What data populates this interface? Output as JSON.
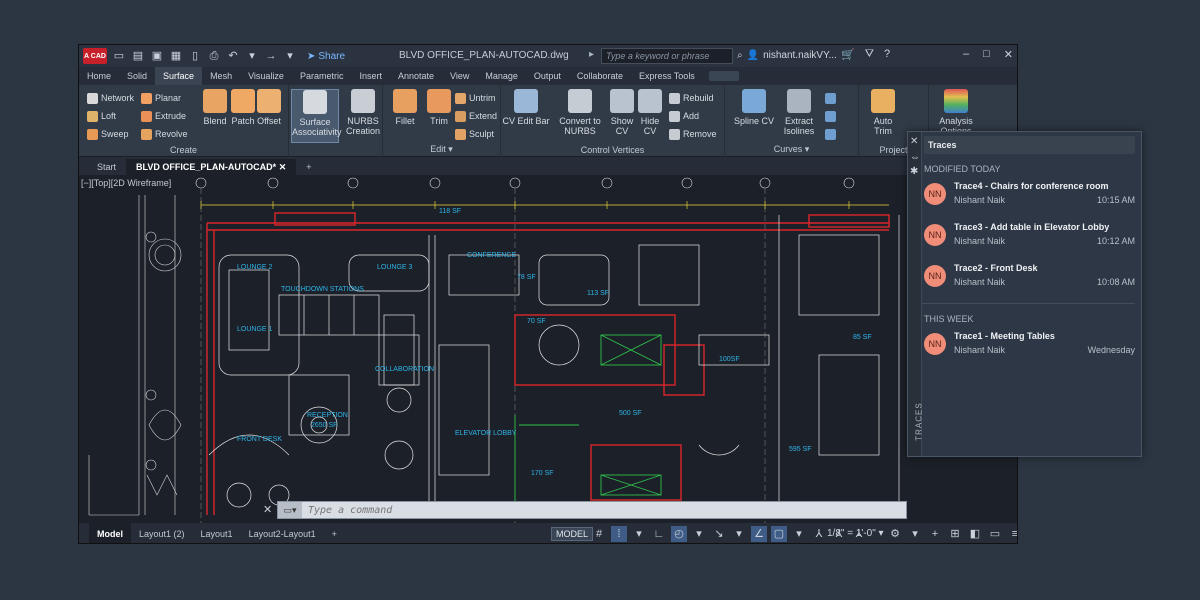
{
  "titlebar": {
    "app_badge": "A CAD",
    "share": "Share",
    "doc_title": "BLVD OFFICE_PLAN-AUTOCAD.dwg",
    "search_placeholder": "Type a keyword or phrase",
    "user": "nishant.naikVY...",
    "window_controls": [
      "–",
      "□",
      "✕"
    ]
  },
  "menu": {
    "tabs": [
      "Home",
      "Solid",
      "Surface",
      "Mesh",
      "Visualize",
      "Parametric",
      "Insert",
      "Annotate",
      "View",
      "Manage",
      "Output",
      "Collaborate",
      "Express Tools"
    ],
    "active": "Surface"
  },
  "ribbon": {
    "create": {
      "title": "Create",
      "small": [
        "Network",
        "Loft",
        "Sweep",
        "Planar",
        "Extrude",
        "Revolve"
      ],
      "big": [
        "Blend",
        "Patch",
        "Offset"
      ]
    },
    "surface_assoc": [
      "Surface",
      "Associativity"
    ],
    "nurbs_creation": [
      "NURBS",
      "Creation"
    ],
    "edit": {
      "title": "Edit",
      "big": [
        "Fillet",
        "Trim"
      ],
      "small": [
        "Untrim",
        "Extend",
        "Sculpt"
      ]
    },
    "control_vertices": {
      "title": "Control Vertices",
      "cv_edit_bar": "CV Edit Bar",
      "convert": [
        "Convert to",
        "NURBS"
      ],
      "show_cv": [
        "Show",
        "CV"
      ],
      "hide_cv": [
        "Hide",
        "CV"
      ],
      "small": [
        "Rebuild",
        "Add",
        "Remove"
      ]
    },
    "curves": {
      "title": "Curves",
      "spline_cv": "Spline CV",
      "extract": [
        "Extract",
        "Isolines"
      ]
    },
    "project": {
      "title": "Project",
      "auto": [
        "Auto",
        "Trim"
      ]
    },
    "analysis": [
      "Analysis",
      "Options"
    ]
  },
  "filetabs": {
    "start": "Start",
    "active": "BLVD OFFICE_PLAN-AUTOCAD*",
    "add": "+"
  },
  "canvas": {
    "view_label": "[−][Top][2D Wireframe]",
    "rooms": [
      "LOUNGE 2",
      "LOUNGE 3",
      "TOUCHDOWN STATIONS",
      "LOUNGE 1",
      "COLLABORATION",
      "RECEPTION",
      "2650 SF",
      "FRONT DESK",
      "CONFERENCE",
      "ELEVATOR LOBBY",
      "118 SF",
      "78 SF",
      "113 SF",
      "70 SF",
      "500 SF",
      "100SF",
      "595 SF",
      "170 SF",
      "85 SF"
    ],
    "cmd_placeholder": "Type a command"
  },
  "statusbar": {
    "tabs": [
      "Model",
      "Layout1 (2)",
      "Layout1",
      "Layout2-Layout1"
    ],
    "active": "Model",
    "add": "+",
    "model_button": "MODEL",
    "scale": "1/8\" = 1'-0\""
  },
  "traces": {
    "title": "Traces",
    "side_label": "TRACES",
    "sections": [
      {
        "label": "MODIFIED TODAY",
        "items": [
          {
            "initials": "NN",
            "title": "Trace4 - Chairs for conference room",
            "author": "Nishant Naik",
            "time": "10:15 AM"
          },
          {
            "initials": "NN",
            "title": "Trace3 - Add table in Elevator Lobby",
            "author": "Nishant Naik",
            "time": "10:12 AM"
          },
          {
            "initials": "NN",
            "title": "Trace2 - Front Desk",
            "author": "Nishant Naik",
            "time": "10:08 AM"
          }
        ]
      },
      {
        "label": "THIS WEEK",
        "items": [
          {
            "initials": "NN",
            "title": "Trace1 - Meeting Tables",
            "author": "Nishant Naik",
            "time": "Wednesday"
          }
        ]
      }
    ]
  },
  "colors": {
    "background": "#2c3542",
    "canvas": "#1c2129",
    "wall_red": "#d9262b",
    "line_white": "#e6e6e6",
    "dim_yellow": "#e6d23a",
    "room_cyan": "#2fb3e8",
    "green": "#2fbf4a",
    "avatar": "#f08d78",
    "accent_blue": "#7ab8ff"
  }
}
